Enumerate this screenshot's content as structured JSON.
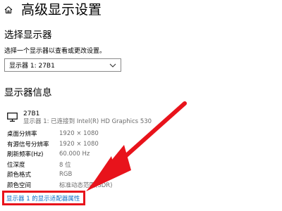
{
  "header": {
    "title": "高级显示设置",
    "home_icon": "home-icon"
  },
  "select_display": {
    "heading": "选择显示器",
    "instruction": "选择一个显示器以查看或更改设置。",
    "selected": "显示器 1: 27B1"
  },
  "display_info": {
    "heading": "显示器信息",
    "monitor_name": "27B1",
    "monitor_desc": "显示器 1: 已连接到 Intel(R) HD Graphics 530",
    "rows": [
      {
        "label": "桌面分辨率",
        "value": "1920 × 1080"
      },
      {
        "label": "有源信号分辨率",
        "value": "1920 × 1080"
      },
      {
        "label": "刷新频率(Hz)",
        "value": "60.000 Hz"
      },
      {
        "label": "位深度",
        "value": "8 位"
      },
      {
        "label": "颜色格式",
        "value": "RGB"
      },
      {
        "label": "颜色空间",
        "value": "标准动态范围(SDR)"
      }
    ],
    "adapter_link": "显示器 1 的显示适配器属性"
  },
  "colors": {
    "link": "#0a6cc5",
    "highlight": "#e8131b"
  }
}
